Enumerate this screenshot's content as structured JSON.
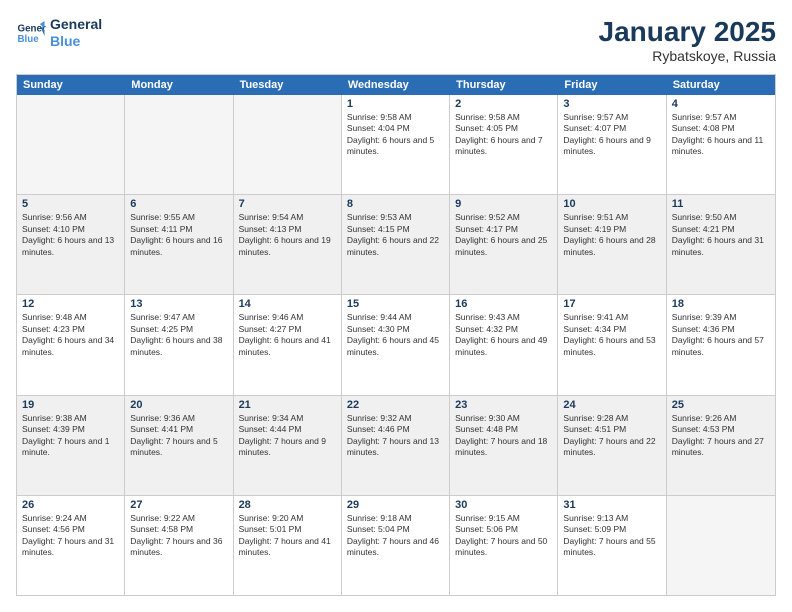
{
  "logo": {
    "line1": "General",
    "line2": "Blue"
  },
  "title": "January 2025",
  "subtitle": "Rybatskoye, Russia",
  "header_days": [
    "Sunday",
    "Monday",
    "Tuesday",
    "Wednesday",
    "Thursday",
    "Friday",
    "Saturday"
  ],
  "rows": [
    [
      {
        "day": "",
        "info": "",
        "empty": true
      },
      {
        "day": "",
        "info": "",
        "empty": true
      },
      {
        "day": "",
        "info": "",
        "empty": true
      },
      {
        "day": "1",
        "info": "Sunrise: 9:58 AM\nSunset: 4:04 PM\nDaylight: 6 hours and 5 minutes."
      },
      {
        "day": "2",
        "info": "Sunrise: 9:58 AM\nSunset: 4:05 PM\nDaylight: 6 hours and 7 minutes."
      },
      {
        "day": "3",
        "info": "Sunrise: 9:57 AM\nSunset: 4:07 PM\nDaylight: 6 hours and 9 minutes."
      },
      {
        "day": "4",
        "info": "Sunrise: 9:57 AM\nSunset: 4:08 PM\nDaylight: 6 hours and 11 minutes."
      }
    ],
    [
      {
        "day": "5",
        "info": "Sunrise: 9:56 AM\nSunset: 4:10 PM\nDaylight: 6 hours and 13 minutes.",
        "shaded": true
      },
      {
        "day": "6",
        "info": "Sunrise: 9:55 AM\nSunset: 4:11 PM\nDaylight: 6 hours and 16 minutes.",
        "shaded": true
      },
      {
        "day": "7",
        "info": "Sunrise: 9:54 AM\nSunset: 4:13 PM\nDaylight: 6 hours and 19 minutes.",
        "shaded": true
      },
      {
        "day": "8",
        "info": "Sunrise: 9:53 AM\nSunset: 4:15 PM\nDaylight: 6 hours and 22 minutes.",
        "shaded": true
      },
      {
        "day": "9",
        "info": "Sunrise: 9:52 AM\nSunset: 4:17 PM\nDaylight: 6 hours and 25 minutes.",
        "shaded": true
      },
      {
        "day": "10",
        "info": "Sunrise: 9:51 AM\nSunset: 4:19 PM\nDaylight: 6 hours and 28 minutes.",
        "shaded": true
      },
      {
        "day": "11",
        "info": "Sunrise: 9:50 AM\nSunset: 4:21 PM\nDaylight: 6 hours and 31 minutes.",
        "shaded": true
      }
    ],
    [
      {
        "day": "12",
        "info": "Sunrise: 9:48 AM\nSunset: 4:23 PM\nDaylight: 6 hours and 34 minutes."
      },
      {
        "day": "13",
        "info": "Sunrise: 9:47 AM\nSunset: 4:25 PM\nDaylight: 6 hours and 38 minutes."
      },
      {
        "day": "14",
        "info": "Sunrise: 9:46 AM\nSunset: 4:27 PM\nDaylight: 6 hours and 41 minutes."
      },
      {
        "day": "15",
        "info": "Sunrise: 9:44 AM\nSunset: 4:30 PM\nDaylight: 6 hours and 45 minutes."
      },
      {
        "day": "16",
        "info": "Sunrise: 9:43 AM\nSunset: 4:32 PM\nDaylight: 6 hours and 49 minutes."
      },
      {
        "day": "17",
        "info": "Sunrise: 9:41 AM\nSunset: 4:34 PM\nDaylight: 6 hours and 53 minutes."
      },
      {
        "day": "18",
        "info": "Sunrise: 9:39 AM\nSunset: 4:36 PM\nDaylight: 6 hours and 57 minutes."
      }
    ],
    [
      {
        "day": "19",
        "info": "Sunrise: 9:38 AM\nSunset: 4:39 PM\nDaylight: 7 hours and 1 minute.",
        "shaded": true
      },
      {
        "day": "20",
        "info": "Sunrise: 9:36 AM\nSunset: 4:41 PM\nDaylight: 7 hours and 5 minutes.",
        "shaded": true
      },
      {
        "day": "21",
        "info": "Sunrise: 9:34 AM\nSunset: 4:44 PM\nDaylight: 7 hours and 9 minutes.",
        "shaded": true
      },
      {
        "day": "22",
        "info": "Sunrise: 9:32 AM\nSunset: 4:46 PM\nDaylight: 7 hours and 13 minutes.",
        "shaded": true
      },
      {
        "day": "23",
        "info": "Sunrise: 9:30 AM\nSunset: 4:48 PM\nDaylight: 7 hours and 18 minutes.",
        "shaded": true
      },
      {
        "day": "24",
        "info": "Sunrise: 9:28 AM\nSunset: 4:51 PM\nDaylight: 7 hours and 22 minutes.",
        "shaded": true
      },
      {
        "day": "25",
        "info": "Sunrise: 9:26 AM\nSunset: 4:53 PM\nDaylight: 7 hours and 27 minutes.",
        "shaded": true
      }
    ],
    [
      {
        "day": "26",
        "info": "Sunrise: 9:24 AM\nSunset: 4:56 PM\nDaylight: 7 hours and 31 minutes."
      },
      {
        "day": "27",
        "info": "Sunrise: 9:22 AM\nSunset: 4:58 PM\nDaylight: 7 hours and 36 minutes."
      },
      {
        "day": "28",
        "info": "Sunrise: 9:20 AM\nSunset: 5:01 PM\nDaylight: 7 hours and 41 minutes."
      },
      {
        "day": "29",
        "info": "Sunrise: 9:18 AM\nSunset: 5:04 PM\nDaylight: 7 hours and 46 minutes."
      },
      {
        "day": "30",
        "info": "Sunrise: 9:15 AM\nSunset: 5:06 PM\nDaylight: 7 hours and 50 minutes."
      },
      {
        "day": "31",
        "info": "Sunrise: 9:13 AM\nSunset: 5:09 PM\nDaylight: 7 hours and 55 minutes."
      },
      {
        "day": "",
        "info": "",
        "empty": true
      }
    ]
  ]
}
